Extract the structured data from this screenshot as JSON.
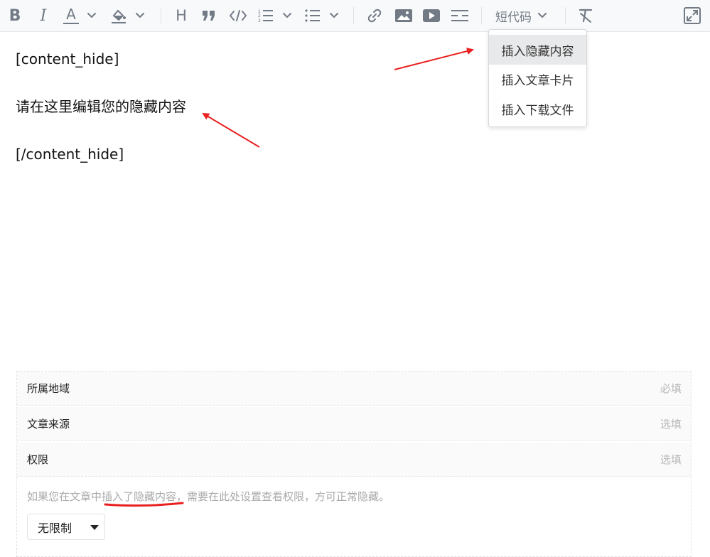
{
  "toolbar": {
    "icons": [
      "bold-icon",
      "italic-icon",
      "font-color-icon",
      "chevron-down-icon",
      "highlight-color-icon",
      "chevron-down-icon",
      "heading-icon",
      "quote-icon",
      "code-icon",
      "ordered-list-icon",
      "chevron-down-icon",
      "unordered-list-icon",
      "chevron-down-icon",
      "link-icon",
      "image-icon",
      "video-icon",
      "divider-icon",
      "clear-format-icon",
      "fullscreen-icon"
    ],
    "bold_label": "B",
    "italic_label": "I",
    "font_color_label": "A",
    "heading_label": "H",
    "shortcode_label": "短代码",
    "colors": {
      "icon": "#727a86",
      "background": "#f8f9fa"
    }
  },
  "shortcode_menu": {
    "items": [
      "插入隐藏内容",
      "插入文章卡片",
      "插入下载文件"
    ],
    "active_index": 0
  },
  "editor": {
    "lines": [
      "[content_hide]",
      "请在这里编辑您的隐藏内容",
      "[/content_hide]"
    ]
  },
  "form": {
    "rows": [
      {
        "label": "所属地域",
        "hint": "必填"
      },
      {
        "label": "文章来源",
        "hint": "选填"
      },
      {
        "label": "权限",
        "hint": "选填"
      }
    ],
    "notice_before": "如果您在文章中",
    "notice_highlight": "插入了隐藏内容",
    "notice_after": "，需要在此处设置查看权限，方可正常隐藏。",
    "permission_select": {
      "value": "无限制"
    }
  },
  "annotations": {
    "arrow_color": "#e8201f",
    "underline_color": "#e8201f"
  }
}
